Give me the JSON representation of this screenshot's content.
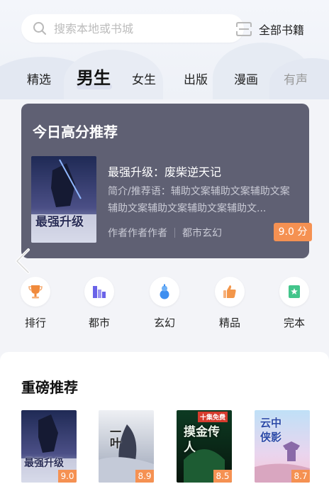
{
  "search": {
    "placeholder": "搜索本地或书城",
    "all_books_label": "全部书籍"
  },
  "tabs": [
    {
      "label": "精选",
      "active": false
    },
    {
      "label": "男生",
      "active": true
    },
    {
      "label": "女生",
      "active": false
    },
    {
      "label": "出版",
      "active": false
    },
    {
      "label": "漫画",
      "active": false
    },
    {
      "label": "有声",
      "active": false
    }
  ],
  "recommend": {
    "section_title": "今日高分推荐",
    "book_title": "最强升级：废柴逆天记",
    "intro": "简介/推荐语：辅助文案辅助文案辅助文案辅助文案辅助文案辅助文案辅助文...",
    "author": "作者作者作者",
    "genre": "都市玄幻",
    "score": "9.0 分",
    "cover_text": "最强升级"
  },
  "categories": [
    {
      "label": "排行",
      "icon": "trophy-icon",
      "color": "#f08a3c"
    },
    {
      "label": "都市",
      "icon": "city-icon",
      "color": "#6a63e8"
    },
    {
      "label": "玄幻",
      "icon": "gourd-icon",
      "color": "#3d8ef0"
    },
    {
      "label": "精品",
      "icon": "thumbs-up-icon",
      "color": "#f3964a"
    },
    {
      "label": "完本",
      "icon": "book-star-icon",
      "color": "#43c58b"
    }
  ],
  "featured": {
    "title": "重磅推荐",
    "books": [
      {
        "score": "9.0",
        "cover_text": "最强升级"
      },
      {
        "score": "8.9",
        "cover_text": "一叶"
      },
      {
        "score": "8.5",
        "cover_text": "摸金传人",
        "ribbon": "十集免费"
      },
      {
        "score": "8.7",
        "cover_text": "云中侠影"
      }
    ]
  },
  "colors": {
    "accent_orange": "#f59152",
    "card_bg": "#5f6073"
  }
}
